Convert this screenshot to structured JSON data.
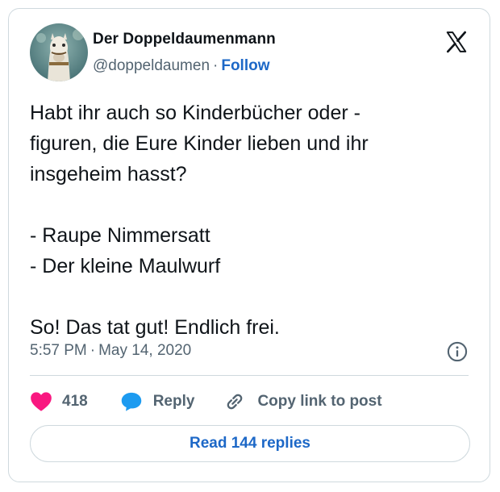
{
  "author": {
    "display_name": "Der Doppeldaumenmann",
    "handle": "@doppeldaumen",
    "separator": "·",
    "follow_label": "Follow",
    "avatar_icon": "horse-avatar"
  },
  "platform_icon": "x-logo-icon",
  "tweet": {
    "text": "Habt ihr auch so Kinderbücher oder -\nfiguren, die Eure Kinder lieben und ihr\ninsgeheim hasst?\n\n- Raupe Nimmersatt\n- Der kleine Maulwurf\n\nSo! Das tat gut! Endlich frei.",
    "time": "5:57 PM",
    "separator": "·",
    "date": "May 14, 2020"
  },
  "actions": {
    "like_count": "418",
    "reply_label": "Reply",
    "copy_label": "Copy link to post"
  },
  "read_replies_label": "Read 144 replies",
  "colors": {
    "link_blue": "#1d68c7",
    "like_pink": "#f91880",
    "reply_blue": "#1d9bf0",
    "muted_text": "#536471",
    "border": "#cfd9de"
  }
}
